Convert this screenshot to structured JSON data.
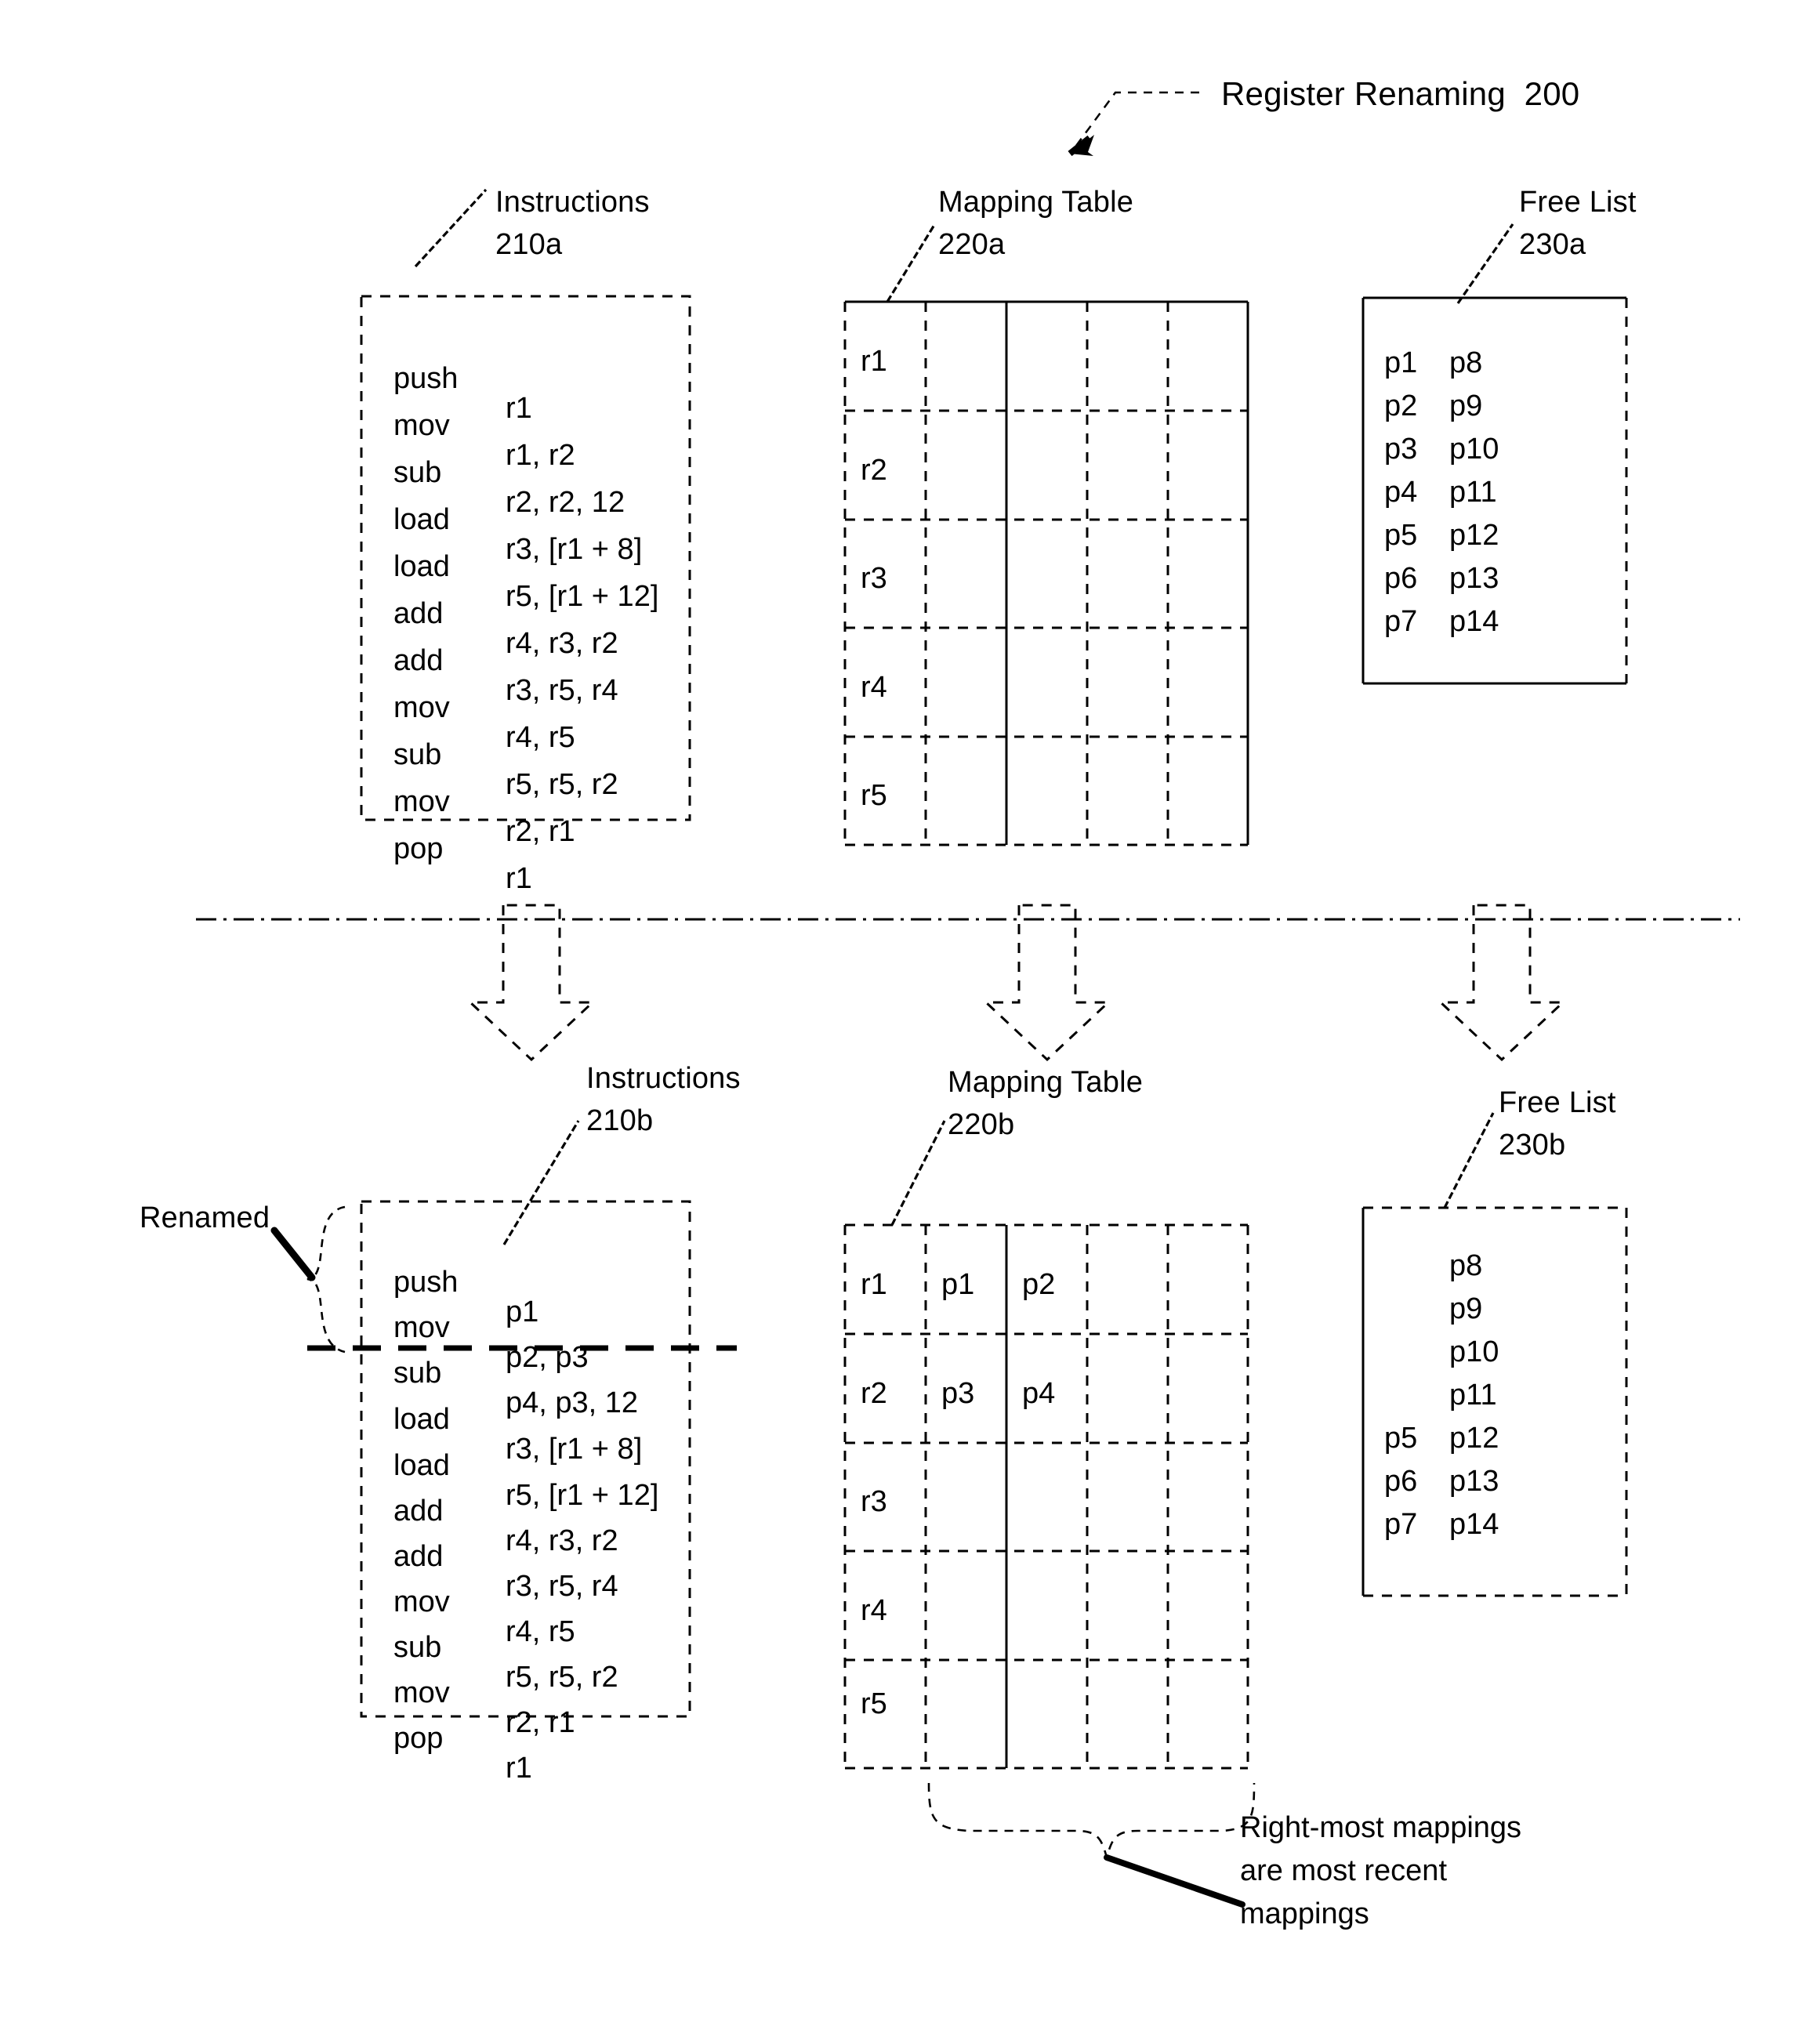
{
  "figure": {
    "title": "Register Renaming  200",
    "renamed_label": "Renamed",
    "note": [
      "Right-most mappings",
      "are most recent",
      "mappings"
    ]
  },
  "top": {
    "instructions": {
      "label_line1": "Instructions",
      "label_line2": "210a",
      "rows": [
        {
          "mnemonic": "push",
          "operands": "r1"
        },
        {
          "mnemonic": "mov",
          "operands": "r1, r2"
        },
        {
          "mnemonic": "sub",
          "operands": "r2, r2, 12"
        },
        {
          "mnemonic": "load",
          "operands": "r3, [r1 + 8]"
        },
        {
          "mnemonic": "load",
          "operands": "r5, [r1 + 12]"
        },
        {
          "mnemonic": "add",
          "operands": "r4, r3, r2"
        },
        {
          "mnemonic": "add",
          "operands": "r3, r5, r4"
        },
        {
          "mnemonic": "mov",
          "operands": "r4, r5"
        },
        {
          "mnemonic": "sub",
          "operands": "r5, r5, r2"
        },
        {
          "mnemonic": "mov",
          "operands": "r2, r1"
        },
        {
          "mnemonic": "pop",
          "operands": "r1"
        }
      ]
    },
    "mapping_table": {
      "label_line1": "Mapping Table",
      "label_line2": "220a",
      "rows": [
        {
          "reg": "r1",
          "cells": [
            "",
            "",
            "",
            ""
          ]
        },
        {
          "reg": "r2",
          "cells": [
            "",
            "",
            "",
            ""
          ]
        },
        {
          "reg": "r3",
          "cells": [
            "",
            "",
            "",
            ""
          ]
        },
        {
          "reg": "r4",
          "cells": [
            "",
            "",
            "",
            ""
          ]
        },
        {
          "reg": "r5",
          "cells": [
            "",
            "",
            "",
            ""
          ]
        }
      ]
    },
    "free_list": {
      "label_line1": "Free List",
      "label_line2": "230a",
      "rows": [
        {
          "left": "p1",
          "right": "p8"
        },
        {
          "left": "p2",
          "right": "p9"
        },
        {
          "left": "p3",
          "right": "p10"
        },
        {
          "left": "p4",
          "right": "p11"
        },
        {
          "left": "p5",
          "right": "p12"
        },
        {
          "left": "p6",
          "right": "p13"
        },
        {
          "left": "p7",
          "right": "p14"
        }
      ]
    }
  },
  "bottom": {
    "instructions": {
      "label_line1": "Instructions",
      "label_line2": "210b",
      "rows": [
        {
          "mnemonic": "push",
          "operands": "p1"
        },
        {
          "mnemonic": "mov",
          "operands": "p2, p3"
        },
        {
          "mnemonic": "sub",
          "operands": "p4, p3, 12"
        },
        {
          "mnemonic": "load",
          "operands": "r3, [r1 + 8]"
        },
        {
          "mnemonic": "load",
          "operands": "r5, [r1 + 12]"
        },
        {
          "mnemonic": "add",
          "operands": "r4, r3, r2"
        },
        {
          "mnemonic": "add",
          "operands": "r3, r5, r4"
        },
        {
          "mnemonic": "mov",
          "operands": "r4, r5"
        },
        {
          "mnemonic": "sub",
          "operands": "r5, r5, r2"
        },
        {
          "mnemonic": "mov",
          "operands": "r2, r1"
        },
        {
          "mnemonic": "pop",
          "operands": "r1"
        }
      ]
    },
    "mapping_table": {
      "label_line1": "Mapping Table",
      "label_line2": "220b",
      "rows": [
        {
          "reg": "r1",
          "cells": [
            "p1",
            "p2",
            "",
            ""
          ]
        },
        {
          "reg": "r2",
          "cells": [
            "p3",
            "p4",
            "",
            ""
          ]
        },
        {
          "reg": "r3",
          "cells": [
            "",
            "",
            "",
            ""
          ]
        },
        {
          "reg": "r4",
          "cells": [
            "",
            "",
            "",
            ""
          ]
        },
        {
          "reg": "r5",
          "cells": [
            "",
            "",
            "",
            ""
          ]
        }
      ]
    },
    "free_list": {
      "label_line1": "Free List",
      "label_line2": "230b",
      "rows": [
        {
          "left": "",
          "right": "p8"
        },
        {
          "left": "",
          "right": "p9"
        },
        {
          "left": "",
          "right": "p10"
        },
        {
          "left": "",
          "right": "p11"
        },
        {
          "left": "p5",
          "right": "p12"
        },
        {
          "left": "p6",
          "right": "p13"
        },
        {
          "left": "p7",
          "right": "p14"
        }
      ]
    }
  }
}
